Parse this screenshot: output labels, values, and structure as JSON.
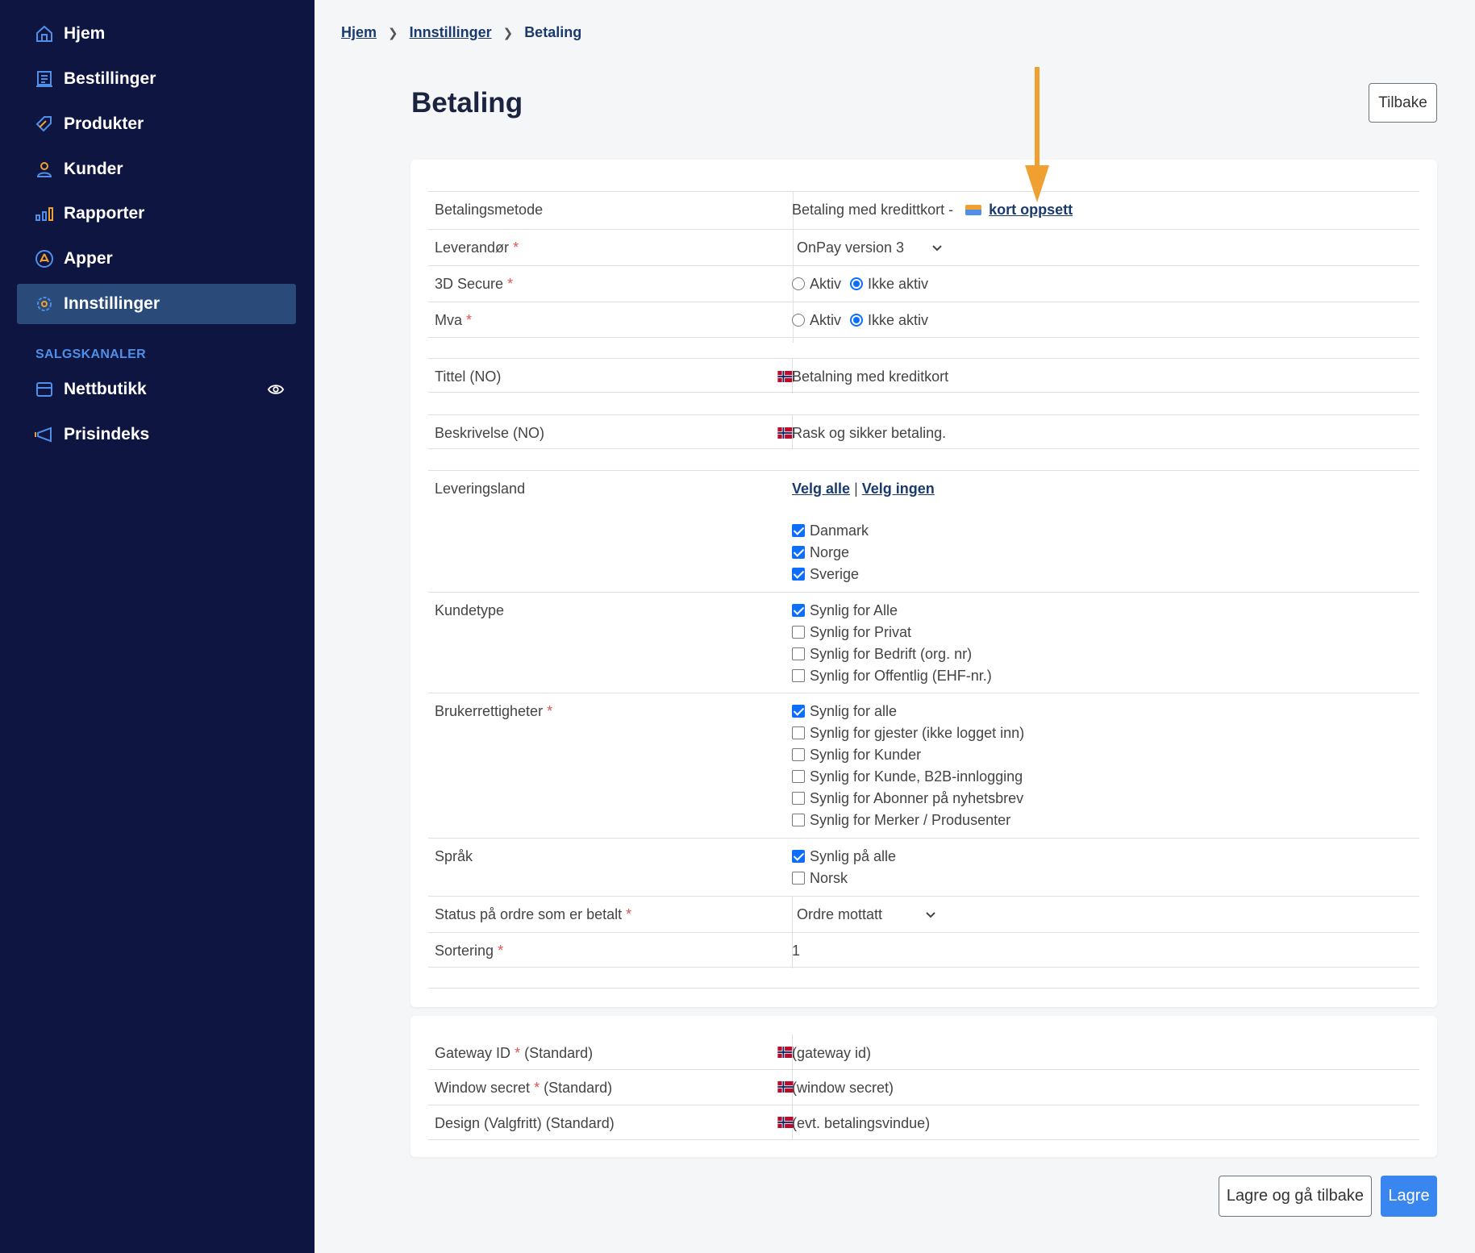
{
  "sidebar": {
    "items": [
      {
        "label": "Hjem",
        "icon": "home-icon"
      },
      {
        "label": "Bestillinger",
        "icon": "orders-icon"
      },
      {
        "label": "Produkter",
        "icon": "tag-icon"
      },
      {
        "label": "Kunder",
        "icon": "user-icon"
      },
      {
        "label": "Rapporter",
        "icon": "bar-chart-icon"
      },
      {
        "label": "Apper",
        "icon": "apps-icon"
      },
      {
        "label": "Innstillinger",
        "icon": "gear-icon",
        "active": true
      }
    ],
    "section_label": "SALGSKANALER",
    "channels": [
      {
        "label": "Nettbutikk",
        "icon": "store-icon"
      },
      {
        "label": "Prisindeks",
        "icon": "megaphone-icon"
      }
    ]
  },
  "breadcrumb": {
    "home": "Hjem",
    "settings": "Innstillinger",
    "current": "Betaling"
  },
  "page_title": "Betaling",
  "back_label": "Tilbake",
  "form": {
    "payment_method": {
      "label": "Betalingsmetode",
      "value": "Betaling med kredittkort -",
      "link": "kort oppsett"
    },
    "provider": {
      "label": "Leverandør",
      "value": "OnPay version 3"
    },
    "secure3d": {
      "label": "3D Secure",
      "opt_active": "Aktiv",
      "opt_inactive": "Ikke aktiv",
      "selected": "Ikke aktiv"
    },
    "vat": {
      "label": "Mva",
      "opt_active": "Aktiv",
      "opt_inactive": "Ikke aktiv",
      "selected": "Ikke aktiv"
    },
    "title": {
      "label": "Tittel (NO)",
      "value": "Betalning med kreditkort"
    },
    "description": {
      "label": "Beskrivelse (NO)",
      "value": "Rask og sikker betaling."
    },
    "delivery_country": {
      "label": "Leveringsland",
      "select_all": "Velg alle",
      "sep": "|",
      "select_none": "Velg ingen",
      "options": [
        {
          "label": "Danmark",
          "checked": true
        },
        {
          "label": "Norge",
          "checked": true
        },
        {
          "label": "Sverige",
          "checked": true
        }
      ]
    },
    "customer_type": {
      "label": "Kundetype",
      "options": [
        {
          "label": "Synlig for Alle",
          "checked": true
        },
        {
          "label": "Synlig for Privat",
          "checked": false
        },
        {
          "label": "Synlig for Bedrift (org. nr)",
          "checked": false
        },
        {
          "label": "Synlig for Offentlig (EHF-nr.)",
          "checked": false
        }
      ]
    },
    "user_rights": {
      "label": "Brukerrettigheter",
      "options": [
        {
          "label": "Synlig for alle",
          "checked": true
        },
        {
          "label": "Synlig for gjester (ikke logget inn)",
          "checked": false
        },
        {
          "label": "Synlig for Kunder",
          "checked": false
        },
        {
          "label": "Synlig for Kunde, B2B-innlogging",
          "checked": false
        },
        {
          "label": "Synlig for Abonner på nyhetsbrev",
          "checked": false
        },
        {
          "label": "Synlig for Merker / Produsenter",
          "checked": false
        }
      ]
    },
    "language": {
      "label": "Språk",
      "options": [
        {
          "label": "Synlig på alle",
          "checked": true
        },
        {
          "label": "Norsk",
          "checked": false
        }
      ]
    },
    "paid_status": {
      "label": "Status på ordre som er betalt",
      "value": "Ordre mottatt"
    },
    "sorting": {
      "label": "Sortering",
      "value": "1"
    }
  },
  "gateway": {
    "gateway_id": {
      "label": "Gateway ID",
      "suffix": "(Standard)",
      "placeholder": "(gateway id)"
    },
    "window_secret": {
      "label": "Window secret",
      "suffix": "(Standard)",
      "placeholder": "(window secret)"
    },
    "design": {
      "label": "Design (Valgfritt) (Standard)",
      "placeholder": "(evt. betalingsvindue)"
    }
  },
  "buttons": {
    "save_back": "Lagre og gå tilbake",
    "save": "Lagre"
  },
  "colors": {
    "sidebar_bg": "#0f1541",
    "active_bg": "#2a4a7a",
    "accent": "#3a86f0",
    "annotation_arrow": "#f0a030",
    "required": "#e0554f"
  }
}
